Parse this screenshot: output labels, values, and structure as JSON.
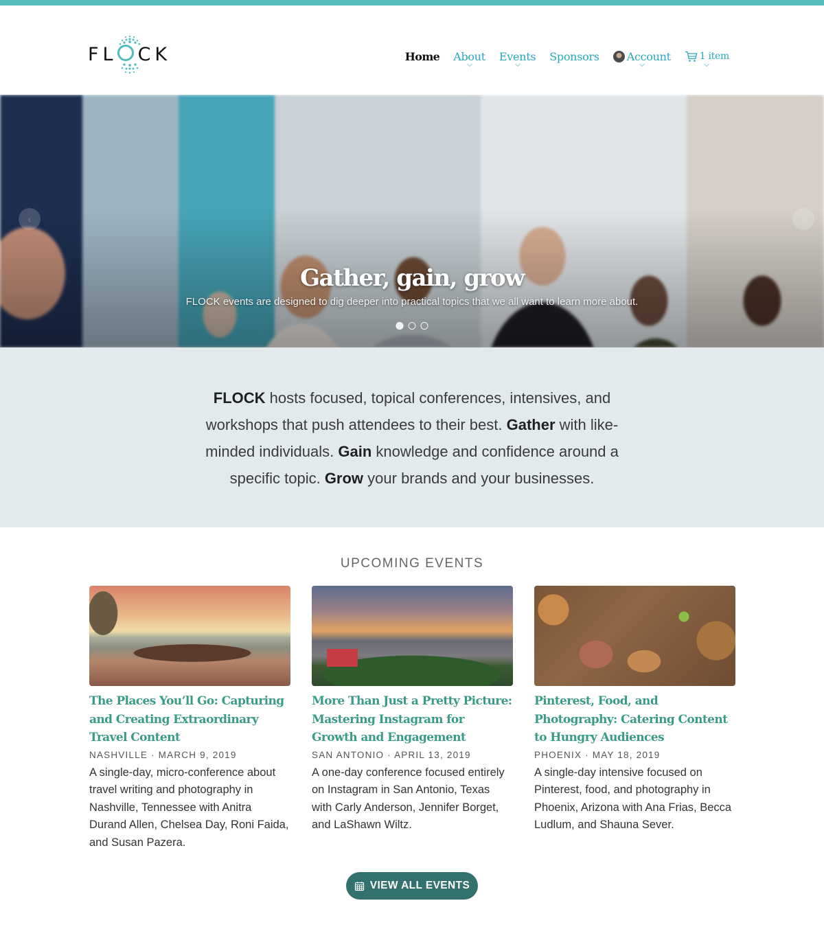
{
  "brand": {
    "name": "FLOCK",
    "accent": "#55bcbc",
    "nav_link_color": "#29a8bd",
    "title_color": "#3a9b88",
    "button_color": "#33716f"
  },
  "nav": {
    "items": [
      {
        "label": "Home",
        "active": true,
        "dropdown": false
      },
      {
        "label": "About",
        "active": false,
        "dropdown": true
      },
      {
        "label": "Events",
        "active": false,
        "dropdown": true
      },
      {
        "label": "Sponsors",
        "active": false,
        "dropdown": false
      },
      {
        "label": "Account",
        "active": false,
        "dropdown": true,
        "icon": "avatar"
      },
      {
        "label": "1 item",
        "active": false,
        "dropdown": true,
        "icon": "cart-icon"
      }
    ]
  },
  "hero": {
    "title": "Gather, gain, grow",
    "subtitle": "FLOCK events are designed to dig deeper into practical topics that we all want to learn more about.",
    "slide_count": 3,
    "active_slide": 1,
    "prev_icon": "chevron-left-icon",
    "next_icon": "chevron-right-icon"
  },
  "intro": {
    "segments": [
      {
        "text": "FLOCK",
        "bold": true
      },
      {
        "text": " hosts focused, topical conferences, intensives, and workshops that push attendees to their best. ",
        "bold": false
      },
      {
        "text": "Gather",
        "bold": true
      },
      {
        "text": " with like-minded individuals. ",
        "bold": false
      },
      {
        "text": "Gain",
        "bold": true
      },
      {
        "text": " knowledge and confidence around a specific topic. ",
        "bold": false
      },
      {
        "text": "Grow",
        "bold": true
      },
      {
        "text": " your brands and your businesses.",
        "bold": false
      }
    ]
  },
  "events": {
    "section_title": "UPCOMING EVENTS",
    "items": [
      {
        "image": "beach-boats-sunset-photo",
        "title": "The Places You’ll Go: Capturing and Creating Extraordinary Travel Content",
        "meta": "NASHVILLE · MARCH 9, 2019",
        "description": "A single-day, micro-conference about travel writing and photography in Nashville, Tennessee with Anitra Durand Allen, Chelsea Day, Roni Faida, and Susan Pazera."
      },
      {
        "image": "city-skyline-photo",
        "title": "More Than Just a Pretty Picture: Mastering Instagram for Growth and Engagement",
        "meta": "SAN ANTONIO · APRIL 13, 2019",
        "description": "A one-day conference focused entirely on Instagram in San Antonio, Texas with Carly Anderson, Jennifer Borget, and LaShawn Wiltz."
      },
      {
        "image": "food-spread-photo",
        "title": "Pinterest, Food, and Photography: Catering Content to Hungry Audiences",
        "meta": "PHOENIX · MAY 18, 2019",
        "description": "A single-day intensive focused on Pinterest, food, and photography in Phoenix, Arizona with Ana Frias, Becca Ludlum, and Shauna Sever."
      }
    ],
    "cta_label": "VIEW ALL EVENTS",
    "cta_icon": "calendar-icon"
  }
}
